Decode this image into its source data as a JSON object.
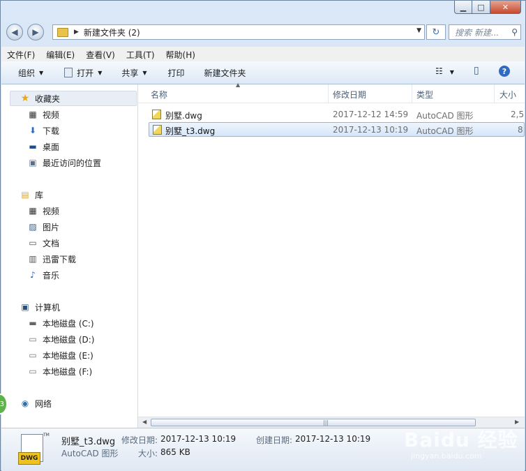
{
  "window": {
    "minimize_glyph": "▁",
    "maximize_glyph": "□",
    "close_glyph": "✕"
  },
  "nav": {
    "back_glyph": "◀",
    "forward_glyph": "▶",
    "path_separator": "▶",
    "path": "新建文件夹 (2)",
    "dropdown_glyph": "▼",
    "refresh_glyph": "↻",
    "search_placeholder": "搜索 新建...",
    "search_icon_glyph": "⚲"
  },
  "menubar": {
    "items": [
      "文件(F)",
      "编辑(E)",
      "查看(V)",
      "工具(T)",
      "帮助(H)"
    ]
  },
  "commandbar": {
    "organize": "组织",
    "open": "打开",
    "share": "共享",
    "print": "打印",
    "new_folder": "新建文件夹",
    "view_glyph": "☷",
    "preview_glyph": "▯",
    "help_glyph": "?"
  },
  "sidebar": {
    "favorites": {
      "label": "收藏夹",
      "items": [
        "视频",
        "下载",
        "桌面",
        "最近访问的位置"
      ]
    },
    "libraries": {
      "label": "库",
      "items": [
        "视频",
        "图片",
        "文档",
        "迅雷下载",
        "音乐"
      ]
    },
    "computer": {
      "label": "计算机",
      "items": [
        "本地磁盘 (C:)",
        "本地磁盘 (D:)",
        "本地磁盘 (E:)",
        "本地磁盘 (F:)"
      ]
    },
    "network": {
      "label": "网络"
    }
  },
  "columns": {
    "name": "名称",
    "modified": "修改日期",
    "type": "类型",
    "size": "大小"
  },
  "files": [
    {
      "name": "别墅.dwg",
      "modified": "2017-12-12 14:59",
      "type": "AutoCAD 图形",
      "size": "2,5"
    },
    {
      "name": "别墅_t3.dwg",
      "modified": "2017-12-13 10:19",
      "type": "AutoCAD 图形",
      "size": "8"
    }
  ],
  "scrollbar": {
    "left_glyph": "◀",
    "right_glyph": "▶",
    "grip": "|||"
  },
  "details": {
    "filename": "别墅_t3.dwg",
    "filetype": "AutoCAD 图形",
    "modified_label": "修改日期:",
    "modified_value": "2017-12-13 10:19",
    "created_label": "创建日期:",
    "created_value": "2017-12-13 10:19",
    "size_label": "大小:",
    "size_value": "865 KB",
    "badge": "DWG",
    "tm": "TM"
  },
  "watermark": {
    "main": "Baidu 经验",
    "sub": "jingyan.baidu.com"
  },
  "side_badge": "3"
}
